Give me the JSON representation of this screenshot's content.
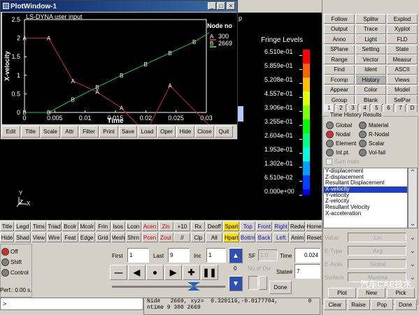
{
  "window": {
    "partial_title": "p"
  },
  "plot_window": {
    "title": "PlotWindow-1",
    "plot_title": "LS-DYNA user input",
    "legend_header": "Node no",
    "legend": [
      {
        "marker": "A",
        "label": "300"
      },
      {
        "marker": "B",
        "label": "2669"
      }
    ],
    "toolbar": [
      "Edit",
      "Title",
      "Scale",
      "Attr",
      "Filter",
      "Print",
      "Save",
      "Load",
      "Oper",
      "Hide",
      "Close",
      "Quit"
    ]
  },
  "chart_data": {
    "type": "line",
    "xlabel": "Time",
    "ylabel": "X-velocity",
    "xlim": [
      0,
      0.03
    ],
    "ylim": [
      0,
      2.5
    ],
    "x_ticks": [
      "0",
      "0.005",
      "0.01",
      "0.015",
      "0.02",
      "0.025",
      "0.03"
    ],
    "y_ticks": [
      "0",
      "0.5",
      "1",
      "1.5",
      "2",
      "2.5"
    ],
    "series": [
      {
        "name": "300",
        "marker": "A",
        "color": "#c03030",
        "x": [
          0,
          0.004,
          0.008,
          0.012,
          0.016,
          0.02,
          0.024,
          0.0305
        ],
        "y": [
          2.0,
          2.0,
          0.85,
          0.55,
          0.12,
          -0.55,
          0.72,
          -0.35
        ]
      },
      {
        "name": "2669",
        "marker": "B",
        "color": "#30c030",
        "x": [
          0,
          0.004,
          0.008,
          0.012,
          0.016,
          0.02,
          0.024,
          0.028,
          0.0305
        ],
        "y": [
          0.0,
          0.0,
          0.35,
          0.68,
          1.0,
          1.3,
          1.6,
          1.9,
          2.15
        ]
      }
    ]
  },
  "fringe": {
    "title": "Fringe Levels",
    "levels": [
      "6.510e-01",
      "5.859e-01",
      "5.208e-01",
      "4.557e-01",
      "3.906e-01",
      "3.255e-01",
      "2.604e-01",
      "1.953e-01",
      "1.302e-01",
      "6.510e-02",
      "0.000e+00"
    ],
    "colors": [
      "#ff0000",
      "#ff6000",
      "#ffc000",
      "#e0ff00",
      "#80ff00",
      "#00ff00",
      "#00ff80",
      "#00ffe0",
      "#00a0ff",
      "#0040ff",
      "#0000ff"
    ]
  },
  "axes_triad": {
    "y": "Y",
    "z": "Z",
    "x": "X"
  },
  "right_panel": {
    "buttons": [
      [
        "Follow",
        "Splitw",
        "Explod"
      ],
      [
        "Output",
        "Trace",
        "Xyplot"
      ],
      [
        "Anno",
        "Light",
        "FLD"
      ],
      [
        "SPlane",
        "Setting",
        "State"
      ],
      [
        "Range",
        "Vector",
        "Measur"
      ],
      [
        "Find",
        "Ident",
        "ASCII"
      ],
      [
        "Fcomp",
        "History",
        "Views"
      ],
      [
        "Appear",
        "Color",
        "Model"
      ],
      [
        "Group",
        "Blank",
        "SelPar"
      ]
    ],
    "tabs": [
      "1",
      "2",
      "3",
      "4",
      "5",
      "6",
      "7",
      "D"
    ],
    "group_title": "Time History Results",
    "radios": [
      {
        "label": "Global",
        "on": false
      },
      {
        "label": "Material",
        "on": false
      },
      {
        "label": "Nodal",
        "on": true
      },
      {
        "label": "R-Nodal",
        "on": false
      },
      {
        "label": "Element",
        "on": false
      },
      {
        "label": "Scalar",
        "on": false
      },
      {
        "label": "Int.pt.",
        "on": false
      },
      {
        "label": "Vol-fail",
        "on": false
      }
    ],
    "sum_mats": "Sum mats",
    "list_items": [
      "Y-displacement",
      "Z-displacement",
      "Resultant Displacement",
      "X-velocity",
      "Y-velocity",
      "Z-velocity",
      "Resultant Velocity",
      "X-acceleration"
    ],
    "selected_item": "X-velocity",
    "fields": [
      {
        "label": "Value",
        "value": "Lin"
      },
      {
        "label": "E-Type",
        "value": "Avg"
      },
      {
        "label": "E-Axes",
        "value": "Global"
      },
      {
        "label": "Surface",
        "value": "Maxima"
      }
    ],
    "bottom_row1": [
      "Plot",
      "New",
      "Pick"
    ],
    "bottom_row2": [
      "Clear",
      "Raise",
      "Pop",
      "Done"
    ]
  },
  "menu_row1": [
    {
      "l": "Title"
    },
    {
      "l": "Legd"
    },
    {
      "l": "Tims"
    },
    {
      "l": "Triad"
    },
    {
      "l": "Bcolr"
    },
    {
      "l": "Mcolr"
    },
    {
      "l": "Frin"
    },
    {
      "l": "Isos"
    },
    {
      "l": "Lcon"
    },
    {
      "l": "Acen",
      "c": "red"
    },
    {
      "l": "Zin",
      "c": "red"
    },
    {
      "l": "+10"
    },
    {
      "l": "Rx"
    },
    {
      "l": "Deoff"
    },
    {
      "l": "Spart",
      "c": "yel"
    },
    {
      "l": "Top",
      "c": "blue"
    },
    {
      "l": "Front",
      "c": "blue"
    },
    {
      "l": "Right",
      "c": "blue"
    },
    {
      "l": "Redw"
    },
    {
      "l": "Home"
    }
  ],
  "menu_row2": [
    {
      "l": "Hide"
    },
    {
      "l": "Shad"
    },
    {
      "l": "View"
    },
    {
      "l": "Wire"
    },
    {
      "l": "Feat"
    },
    {
      "l": "Edge"
    },
    {
      "l": "Grid"
    },
    {
      "l": "Mesh"
    },
    {
      "l": "Shrn"
    },
    {
      "l": "Pcen",
      "c": "red"
    },
    {
      "l": "Zout",
      "c": "red"
    },
    {
      "l": "//"
    },
    {
      "l": "Clp"
    },
    {
      "l": "All"
    },
    {
      "l": "Hpart",
      "c": "yel"
    },
    {
      "l": "Bottm",
      "c": "blue"
    },
    {
      "l": "Back",
      "c": "blue"
    },
    {
      "l": "Left",
      "c": "blue"
    },
    {
      "l": "Anim"
    },
    {
      "l": "Reset"
    }
  ],
  "anim": {
    "radios": [
      {
        "label": "Off",
        "on": true
      },
      {
        "label": "Shift",
        "on": false
      },
      {
        "label": "Control",
        "on": false
      }
    ],
    "perf": "Perf.: 0.00 s.",
    "first_label": "First",
    "first": "1",
    "last_label": "Last",
    "last": "9",
    "inc_label": "Inc",
    "inc": "1",
    "time_label": "Time",
    "time": "0.024",
    "state_label": "State#",
    "state": "7",
    "sf_label": "SF",
    "sf": "1.0",
    "nodiv_label": "No.of Div",
    "counter": "0",
    "done": "Done"
  },
  "status": {
    "prompt": ">",
    "line1": "Nid#   2669, xyz=  0.320116,-0.0177704,         0",
    "line2": "ntime 9 300 2669",
    "watermark": "汽车CAE技术"
  }
}
